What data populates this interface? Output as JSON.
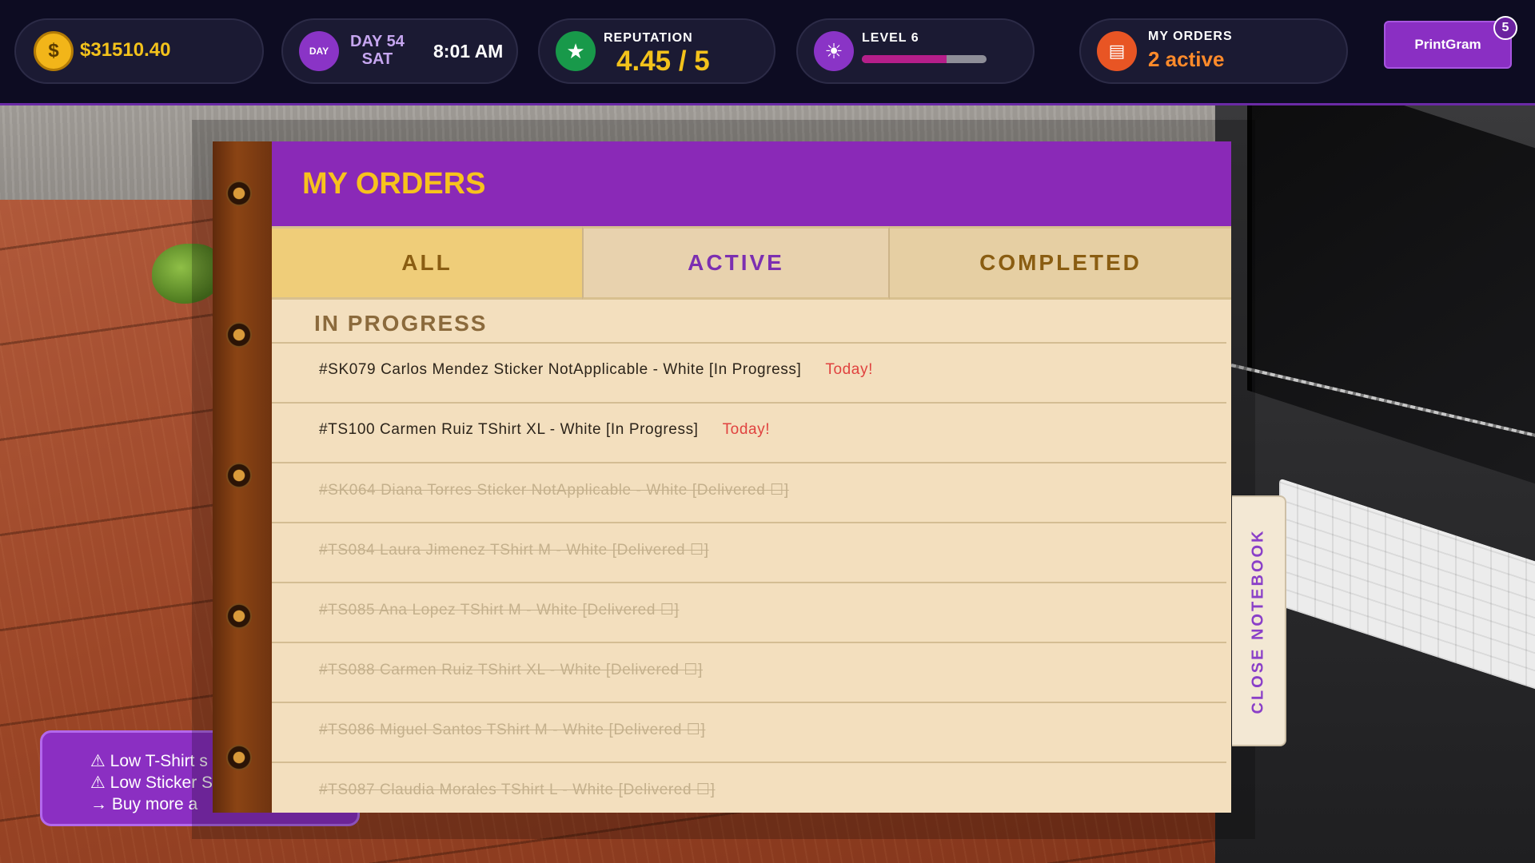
{
  "hud": {
    "money": "$31510.40",
    "money_icon": "$",
    "day_badge": "DAY",
    "day_number": "DAY 54",
    "weekday": "SAT",
    "time": "8:01 AM",
    "reputation_label": "REPUTATION",
    "reputation_value": "4.45 / 5",
    "reputation_icon": "★",
    "level_label": "LEVEL  6",
    "level_progress": 0.68,
    "level_icon": "☀",
    "orders_label": "MY ORDERS",
    "orders_value": "2 active",
    "orders_icon": "▤",
    "printgram_label": "PrintGram",
    "printgram_count": "5"
  },
  "warning": {
    "line1": "⚠ Low T-Shirt s",
    "line2": "⚠ Low Sticker S",
    "line3": "→ Buy more a"
  },
  "notebook": {
    "title": "MY ORDERS",
    "tabs": {
      "all": "ALL",
      "active": "ACTIVE",
      "completed": "COMPLETED"
    },
    "section_title": "IN PROGRESS",
    "close_label": "CLOSE NOTEBOOK",
    "orders": [
      {
        "text": "#SK079  Carlos Mendez  Sticker NotApplicable - White  [In Progress]",
        "due": "Today!"
      },
      {
        "text": "#TS100  Carmen Ruiz  TShirt XL - White  [In Progress]",
        "due": "Today!"
      },
      {
        "text": "#SK064  Diana Torres  Sticker NotApplicable - White  [Delivered ☐]"
      },
      {
        "text": "#TS084  Laura Jimenez  TShirt M - White  [Delivered ☐]"
      },
      {
        "text": "#TS085  Ana Lopez  TShirt M - White  [Delivered ☐]"
      },
      {
        "text": "#TS088  Carmen Ruiz  TShirt XL - White  [Delivered ☐]"
      },
      {
        "text": "#TS086  Miguel Santos  TShirt M - White  [Delivered ☐]"
      },
      {
        "text": "#TS087  Claudia Morales  TShirt L - White  [Delivered ☐]"
      }
    ]
  },
  "colors": {
    "accent_purple": "#8a29b7",
    "gold": "#f3c21b",
    "due_red": "#e0423f"
  }
}
